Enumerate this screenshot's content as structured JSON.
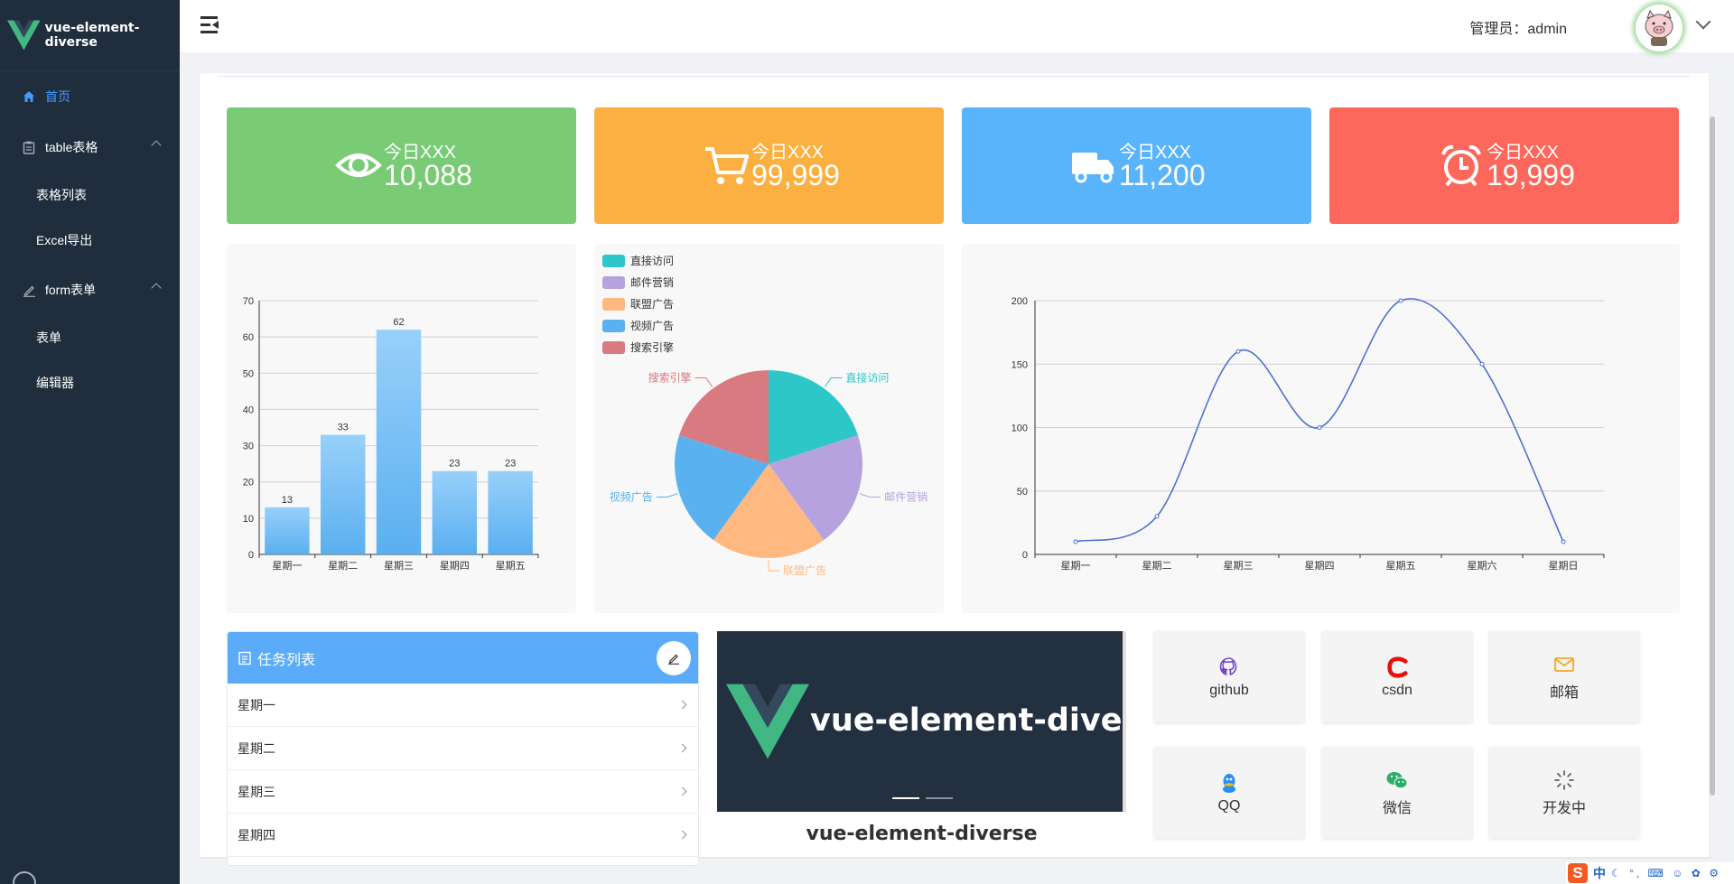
{
  "app": {
    "logo_text": "vue-element-diverse"
  },
  "sidebar": {
    "items": [
      {
        "label": "首页",
        "icon": "home-icon",
        "active": true
      },
      {
        "label": "table表格",
        "icon": "clipboard-icon",
        "expanded": true,
        "children": [
          {
            "label": "表格列表"
          },
          {
            "label": "Excel导出"
          }
        ]
      },
      {
        "label": "form表单",
        "icon": "edit-icon",
        "expanded": true,
        "children": [
          {
            "label": "表单"
          },
          {
            "label": "编辑器"
          }
        ]
      }
    ]
  },
  "header": {
    "user_label": "管理员：admin",
    "avatar": "pig-avatar"
  },
  "stats": [
    {
      "label": "今日XXX",
      "value": "10,088",
      "icon": "eye-icon",
      "color": "#79cb75"
    },
    {
      "label": "今日XXX",
      "value": "99,999",
      "icon": "cart-icon",
      "color": "#fbb041"
    },
    {
      "label": "今日XXX",
      "value": "11,200",
      "icon": "truck-icon",
      "color": "#5ab4fb"
    },
    {
      "label": "今日XXX",
      "value": "19,999",
      "icon": "alarm-clock-icon",
      "color": "#fe675b"
    }
  ],
  "chart_data": [
    {
      "type": "bar",
      "categories": [
        "星期一",
        "星期二",
        "星期三",
        "星期四",
        "星期五"
      ],
      "values": [
        13,
        33,
        62,
        23,
        23
      ],
      "ylim": [
        0,
        70
      ],
      "yticks": [
        0,
        10,
        20,
        30,
        40,
        50,
        60,
        70
      ],
      "grid": true,
      "colors": [
        "#98d0fa",
        "#5aaff0"
      ]
    },
    {
      "type": "pie",
      "legend": "top-left",
      "slices": [
        {
          "name": "直接访问",
          "value": 20,
          "color": "#2ec7c9"
        },
        {
          "name": "邮件营销",
          "value": 20,
          "color": "#b6a2de"
        },
        {
          "name": "联盟广告",
          "value": 20,
          "color": "#ffb980"
        },
        {
          "name": "视频广告",
          "value": 20,
          "color": "#5ab1ef"
        },
        {
          "name": "搜索引擎",
          "value": 20,
          "color": "#d87a80"
        }
      ]
    },
    {
      "type": "line",
      "smooth": true,
      "x": [
        "星期一",
        "星期二",
        "星期三",
        "星期四",
        "星期五",
        "星期六",
        "星期日"
      ],
      "values": [
        10,
        30,
        160,
        100,
        200,
        150,
        10
      ],
      "ylim": [
        0,
        200
      ],
      "yticks": [
        0,
        50,
        100,
        150,
        200
      ],
      "grid": true,
      "color": "#4f71d0"
    }
  ],
  "tasks": {
    "title": "任务列表",
    "items": [
      "星期一",
      "星期二",
      "星期三",
      "星期四"
    ]
  },
  "carousel": {
    "banner_text": "vue-element-diverse",
    "caption": "vue-element-diverse",
    "active_index": 0
  },
  "links": [
    {
      "label": "github",
      "icon": "github-icon",
      "color": "#6f42c1"
    },
    {
      "label": "csdn",
      "icon": "csdn-icon",
      "color": "#e80f0f"
    },
    {
      "label": "邮箱",
      "icon": "mail-icon",
      "color": "#f5a623"
    },
    {
      "label": "QQ",
      "icon": "qq-icon",
      "color": "#2a8ef0"
    },
    {
      "label": "微信",
      "icon": "wechat-icon",
      "color": "#2aae67"
    },
    {
      "label": "开发中",
      "icon": "loading-icon",
      "color": "#606266"
    }
  ],
  "ime": {
    "logo": "S",
    "mode": "中"
  }
}
